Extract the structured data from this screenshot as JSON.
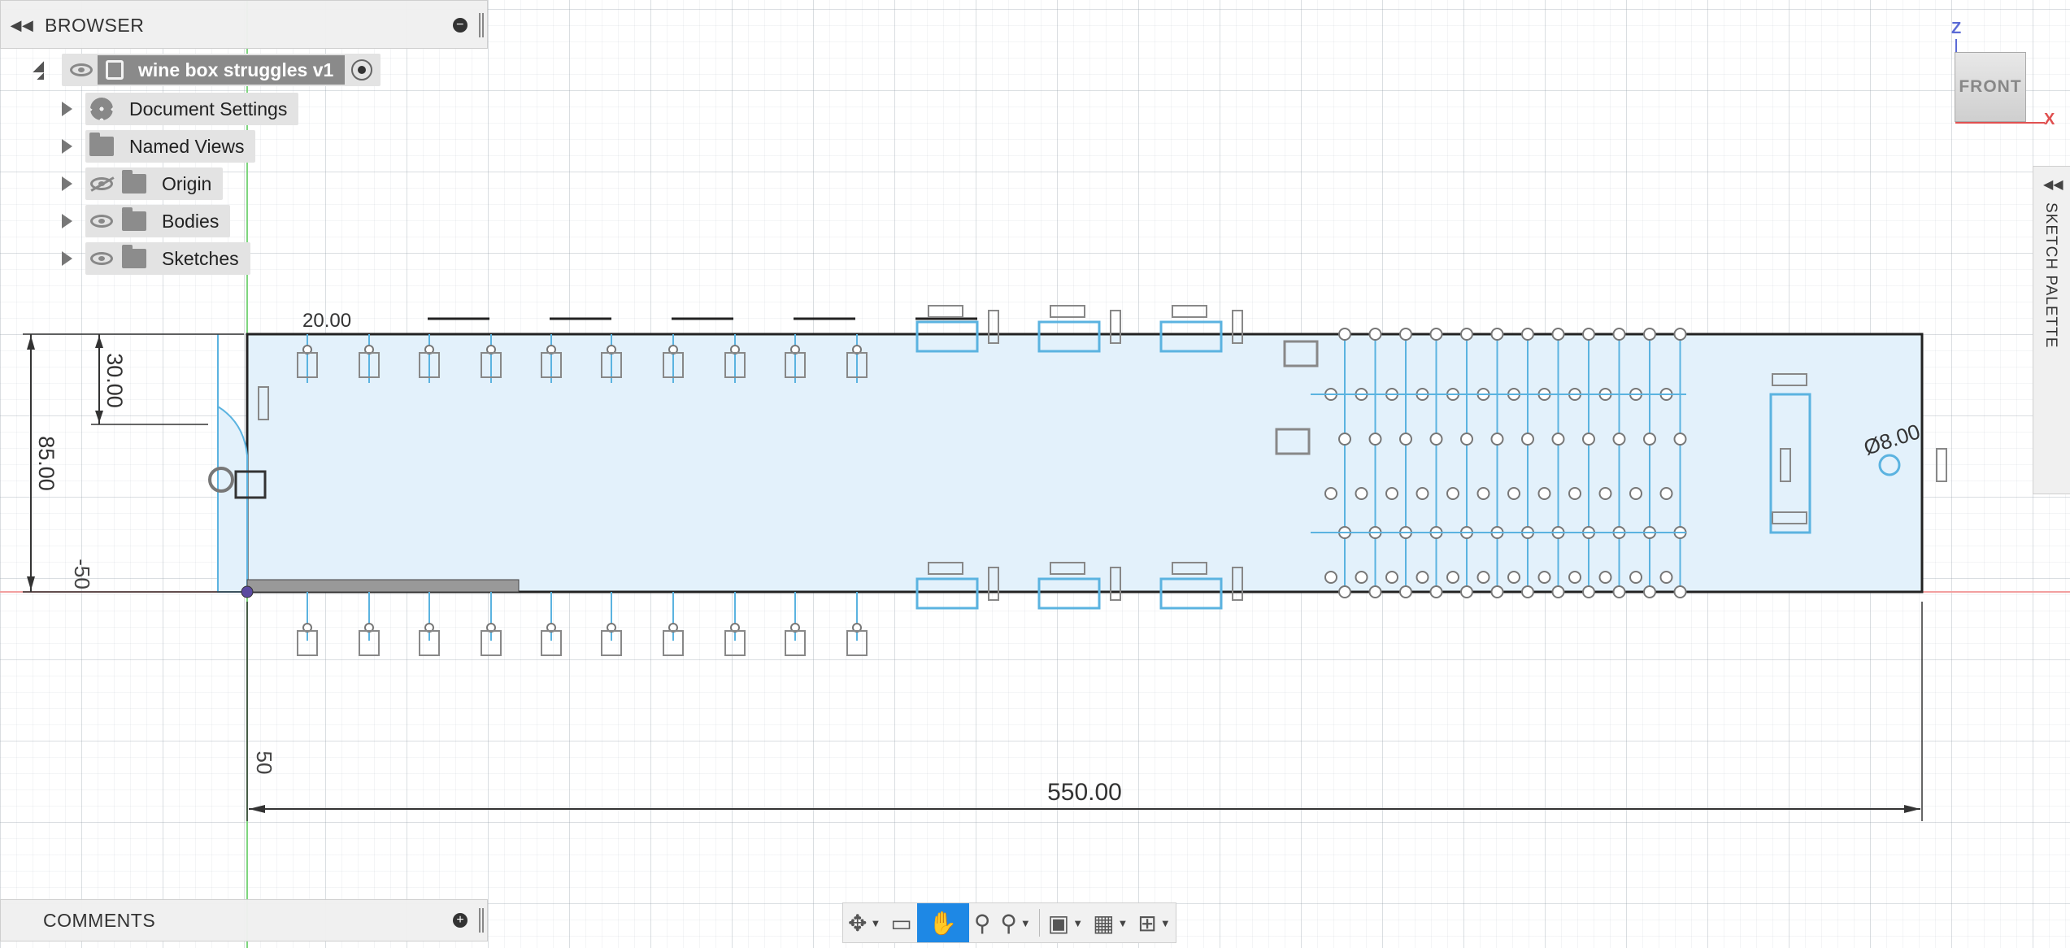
{
  "browser": {
    "title": "BROWSER",
    "collapse_icon": "double-chevron-left-icon",
    "document": "wine box struggles v1",
    "items": [
      {
        "label": "Document Settings",
        "icon": "gear-icon"
      },
      {
        "label": "Named Views",
        "icon": "folder-icon"
      },
      {
        "label": "Origin",
        "icon": "folder-icon",
        "visibility": "hidden"
      },
      {
        "label": "Bodies",
        "icon": "folder-icon",
        "visibility": "visible"
      },
      {
        "label": "Sketches",
        "icon": "folder-icon",
        "visibility": "visible"
      }
    ]
  },
  "comments": {
    "title": "COMMENTS"
  },
  "viewcube": {
    "face": "FRONT",
    "axis_z": "Z",
    "axis_x": "X"
  },
  "palette": {
    "title": "SKETCH PALETTE"
  },
  "dimensions": {
    "d30": "30.00",
    "d85": "85.00",
    "d_neg50": "-50",
    "d50": "50",
    "d550": "550.00",
    "d20": "20.00",
    "d8": "Ø8.00"
  },
  "toolbar": {
    "items": [
      "orbit-icon",
      "look-at-icon",
      "pan-icon",
      "zoom-icon",
      "fit-icon",
      "display-settings-icon",
      "grid-icon",
      "viewports-icon"
    ],
    "active": "pan-icon"
  },
  "colors": {
    "sketch_fill": "#e3f1fb",
    "sketch_line": "#5bb3e0",
    "constraint": "#777777"
  }
}
